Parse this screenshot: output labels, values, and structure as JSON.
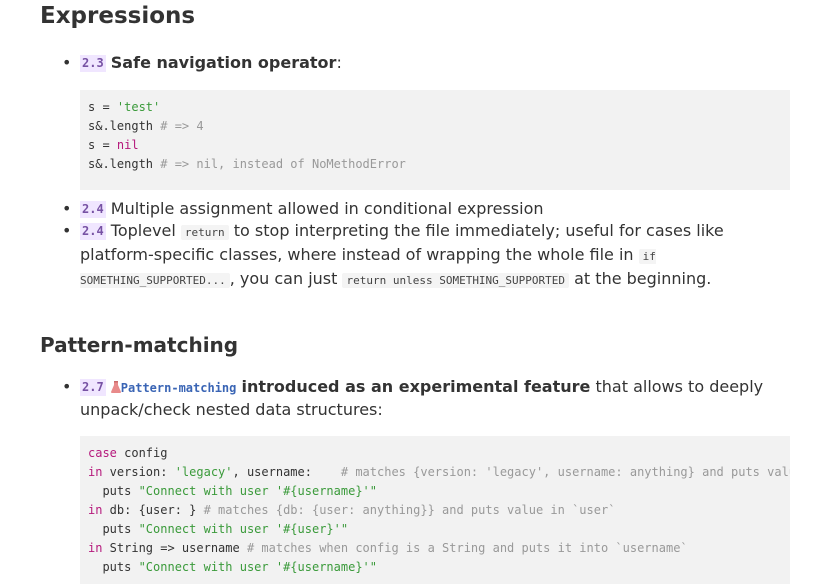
{
  "section1": {
    "title": "Expressions",
    "item1": {
      "version": "2.3",
      "title": "Safe navigation operator",
      "colon": ":"
    },
    "code1": [
      [
        {
          "t": "s = ",
          "c": ""
        },
        {
          "t": "'test'",
          "c": "str"
        }
      ],
      [
        {
          "t": "s&.length ",
          "c": ""
        },
        {
          "t": "# => 4",
          "c": "cm"
        }
      ],
      [
        {
          "t": "s = ",
          "c": ""
        },
        {
          "t": "nil",
          "c": "kw"
        }
      ],
      [
        {
          "t": "s&.length ",
          "c": ""
        },
        {
          "t": "# => nil, instead of NoMethodError",
          "c": "cm"
        }
      ]
    ],
    "item2": {
      "version": "2.4",
      "text": "Multiple assignment allowed in conditional expression"
    },
    "item3": {
      "version": "2.4",
      "t1": "Toplevel",
      "code_a": "return",
      "t2": "to stop interpreting the file immediately; useful for cases like platform-specific classes, where instead of wrapping the whole file in",
      "code_b": "if SOMETHING_SUPPORTED...",
      "t3": ", you can just",
      "code_c": "return unless SOMETHING_SUPPORTED",
      "t4": "at the beginning."
    }
  },
  "section2": {
    "title": "Pattern-matching",
    "item1": {
      "version": "2.7",
      "link": "Pattern-matching",
      "bold": "introduced as an experimental feature",
      "rest": "that allows to deeply unpack/check nested data structures:"
    },
    "code2": [
      [
        {
          "t": "case",
          "c": "kw"
        },
        {
          "t": " config",
          "c": ""
        }
      ],
      [
        {
          "t": "in",
          "c": "kw"
        },
        {
          "t": " version: ",
          "c": ""
        },
        {
          "t": "'legacy'",
          "c": "str"
        },
        {
          "t": ", username:    ",
          "c": ""
        },
        {
          "t": "# matches {version: 'legacy', username: anything} and puts value into `username`",
          "c": "cm"
        }
      ],
      [
        {
          "t": "  puts ",
          "c": ""
        },
        {
          "t": "\"Connect with user '#{username}'\"",
          "c": "str"
        }
      ],
      [
        {
          "t": "in",
          "c": "kw"
        },
        {
          "t": " db: {user: } ",
          "c": ""
        },
        {
          "t": "# matches {db: {user: anything}} and puts value in `user`",
          "c": "cm"
        }
      ],
      [
        {
          "t": "  puts ",
          "c": ""
        },
        {
          "t": "\"Connect with user '#{user}'\"",
          "c": "str"
        }
      ],
      [
        {
          "t": "in",
          "c": "kw"
        },
        {
          "t": " String => username ",
          "c": ""
        },
        {
          "t": "# matches when config is a String and puts it into `username`",
          "c": "cm"
        }
      ],
      [
        {
          "t": "  puts ",
          "c": ""
        },
        {
          "t": "\"Connect with user '#{username}'\"",
          "c": "str"
        }
      ]
    ]
  },
  "colors": {
    "version_badge_bg": "#f0e6ff",
    "version_badge_fg": "#7752a4",
    "link": "#3a65b5",
    "code_bg": "#f2f2f2"
  },
  "icons": {
    "experimental": "flask-icon"
  }
}
